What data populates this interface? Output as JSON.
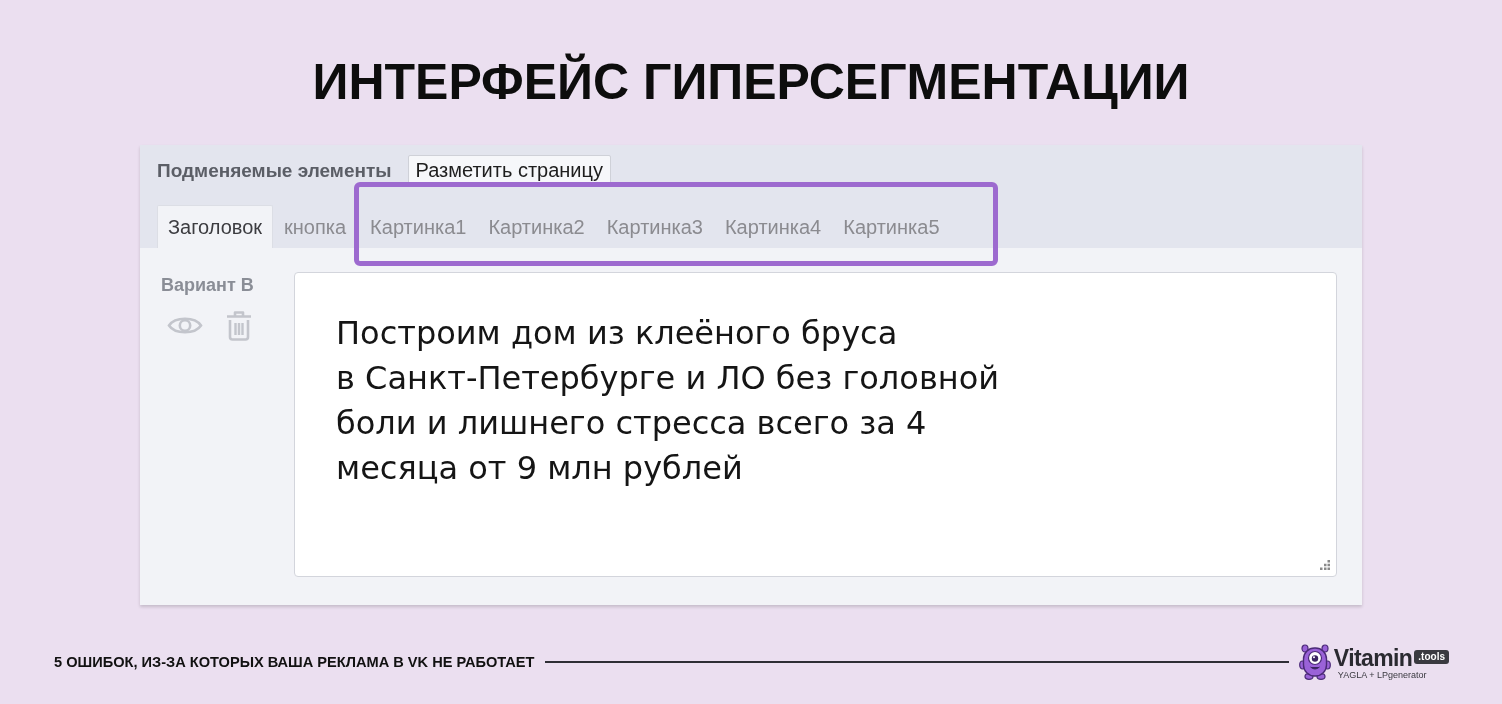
{
  "title": "ИНТЕРФЕЙС ГИПЕРСЕГМЕНТАЦИИ",
  "panel": {
    "label": "Подменяемые элементы",
    "button": "Разметить страницу",
    "tabs": [
      {
        "label": "Заголовок",
        "selected": true
      },
      {
        "label": "кнопка",
        "selected": false
      }
    ],
    "highlight_frame": {
      "tabs": [
        {
          "label": "Картинка1",
          "selected": false
        },
        {
          "label": "Картинка2",
          "selected": false
        },
        {
          "label": "Картинка3",
          "selected": false
        },
        {
          "label": "Картинка4",
          "selected": false
        },
        {
          "label": "Картинка5",
          "selected": false
        }
      ]
    },
    "variant": {
      "label": "Вариант B",
      "value": "Построим дом из клеёного бруса\nв Санкт-Петербурге и ЛО без головной\nболи и лишнего стресса всего за 4\nмесяца от 9 млн рублей"
    }
  },
  "footer": {
    "caption": "5 ОШИБОК, ИЗ-ЗА КОТОРЫХ ВАША РЕКЛАМА В VK НЕ РАБОТАЕТ",
    "logo": {
      "name": "Vitamin",
      "badge": ".tools",
      "tagline": "YAGLA + LPgenerator"
    }
  }
}
